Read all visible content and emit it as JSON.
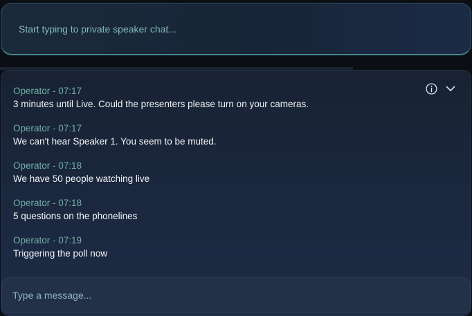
{
  "private_chat": {
    "placeholder": "Start typing to private speaker chat..."
  },
  "chat": {
    "icons": {
      "info": "info-icon",
      "collapse": "chevron-down-icon"
    },
    "messages": [
      {
        "author": "Operator",
        "time": "07:17",
        "meta": "Operator - 07:17",
        "text": "3 minutes until Live. Could the presenters please turn on your cameras."
      },
      {
        "author": "Operator",
        "time": "07:17",
        "meta": "Operator - 07:17",
        "text": "We can't hear Speaker 1. You seem to be muted."
      },
      {
        "author": "Operator",
        "time": "07:18",
        "meta": "Operator - 07:18",
        "text": "We have 50 people watching live"
      },
      {
        "author": "Operator",
        "time": "07:18",
        "meta": "Operator - 07:18",
        "text": "5 questions on the phonelines"
      },
      {
        "author": "Operator",
        "time": "07:19",
        "meta": "Operator - 07:19",
        "text": "Triggering the poll now"
      }
    ]
  },
  "compose": {
    "placeholder": "Type a message..."
  },
  "colors": {
    "accent": "#6fb0a8",
    "message_text": "#f2f4f7",
    "panel_border": "#4a8e98"
  }
}
